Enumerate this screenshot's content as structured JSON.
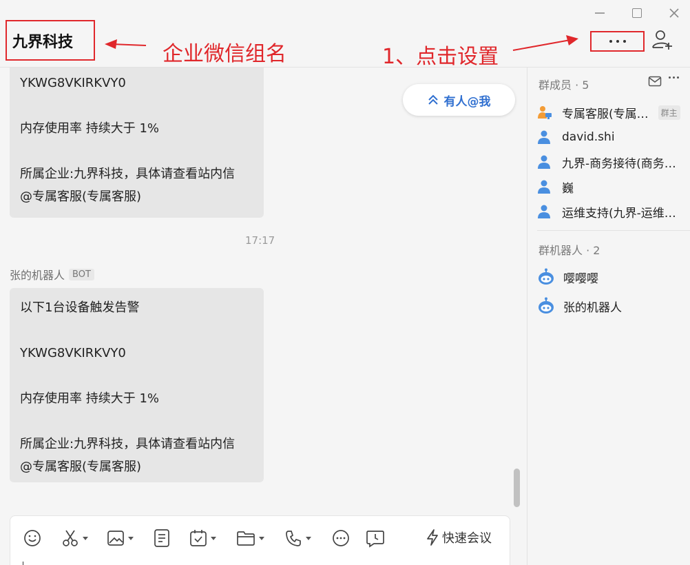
{
  "header": {
    "group_title": "九界科技",
    "annotation_group_name": "企业微信组名",
    "annotation_click_settings": "1、点击设置",
    "annotation_color": "#e0272b"
  },
  "chat": {
    "message_1": {
      "lines": [
        "YKWG8VKIRKVY0",
        "",
        "内存使用率 持续大于 1%",
        "",
        "所属企业:九界科技，具体请查看站内信",
        "@专属客服(专属客服)"
      ]
    },
    "mention_button": "有人@我",
    "timestamp": "17:17",
    "sender_name": "张的机器人",
    "sender_tag": "BOT",
    "message_2": {
      "lines": [
        "以下1台设备触发告警",
        "",
        "YKWG8VKIRKVY0",
        "",
        "内存使用率 持续大于 1%",
        "",
        "所属企业:九界科技，具体请查看站内信",
        "@专属客服(专属客服)"
      ]
    }
  },
  "composer": {
    "quick_meeting": "快速会议",
    "tools": [
      "emoji-icon",
      "scissors-icon",
      "image-icon",
      "document-icon",
      "task-icon",
      "folder-icon",
      "phone-icon",
      "more-icon",
      "schedule-icon"
    ]
  },
  "sidebar": {
    "members_header": "群成员 · 5",
    "members": [
      {
        "name": "专属客服(专属…",
        "tag": "群主"
      },
      {
        "name": "david.shi"
      },
      {
        "name": "九界-商务接待(商务…"
      },
      {
        "name": "巍"
      },
      {
        "name": "运维支持(九界-运维…"
      }
    ],
    "bots_header": "群机器人 · 2",
    "bots": [
      {
        "name": "嘤嘤嘤"
      },
      {
        "name": "张的机器人"
      }
    ],
    "accent_color": "#4a8fe0"
  }
}
